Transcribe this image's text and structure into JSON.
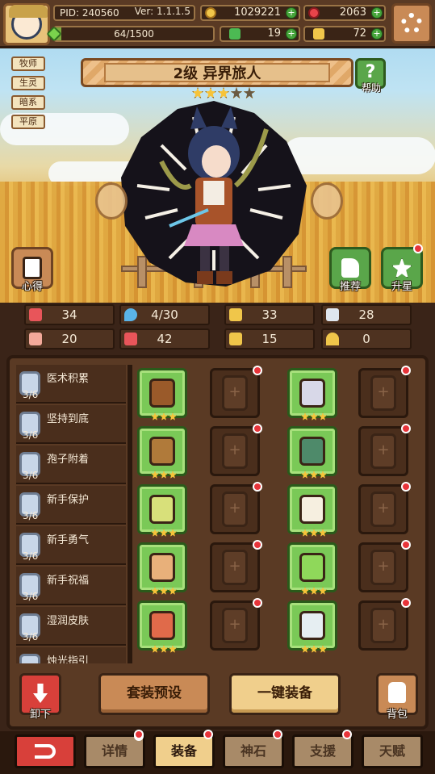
{
  "player": {
    "pid": "PID: 240560",
    "version": "Ver: 1.1.1.5",
    "exp": "64/1500",
    "exp_ratio": 0.043
  },
  "currency": {
    "coins": "1029221",
    "gems": "2063",
    "clover": "19",
    "gold_bars": "72"
  },
  "class_tags": [
    "牧师",
    "生灵",
    "暗系",
    "平原"
  ],
  "hero": {
    "name": "2级  异界旅人",
    "stars_filled": 3,
    "stars_total": 5
  },
  "buttons": {
    "help": "帮助",
    "notes": "心得",
    "recommend": "推荐",
    "star_up": "升星",
    "unequip": "卸下",
    "set_preset": "套装预设",
    "one_click_equip": "一键装备",
    "backpack": "背包"
  },
  "stats": [
    {
      "icon": "heart-icon",
      "value": "34",
      "color": "#e8555a"
    },
    {
      "icon": "water-drop-icon",
      "value": "4/30",
      "color": "#5ab4e8"
    },
    {
      "icon": "shield-icon",
      "value": "33",
      "color": "#f0c64a"
    },
    {
      "icon": "wing-icon",
      "value": "28",
      "color": "#dfe6ee"
    },
    {
      "icon": "fist-icon",
      "value": "20",
      "color": "#f3a99a"
    },
    {
      "icon": "book-icon",
      "value": "42",
      "color": "#e8555a"
    },
    {
      "icon": "boot-icon",
      "value": "15",
      "color": "#f0c64a"
    },
    {
      "icon": "horseshoe-icon",
      "value": "0",
      "color": "#f0c64a"
    }
  ],
  "sets": [
    {
      "name": "医术积累",
      "count": "3/6"
    },
    {
      "name": "坚持到底",
      "count": "3/6"
    },
    {
      "name": "孢子附着",
      "count": "3/6"
    },
    {
      "name": "新手保护",
      "count": "3/6"
    },
    {
      "name": "新手勇气",
      "count": "3/6"
    },
    {
      "name": "新手祝福",
      "count": "3/6"
    },
    {
      "name": "湿润皮肤",
      "count": "3/6"
    },
    {
      "name": "烛光指引",
      "count": ""
    }
  ],
  "equipment": {
    "left_items": [
      "wooden-wand",
      "round-shield",
      "green-amulet",
      "bronze-medal",
      "red-mushroom"
    ],
    "right_items": [
      "cone-hat",
      "leaf-armor",
      "white-glove",
      "green-ring",
      "white-boots"
    ]
  },
  "tabs": {
    "back": "",
    "details": "详情",
    "equip": "装备",
    "stone": "神石",
    "support": "支援",
    "talent": "天赋"
  }
}
